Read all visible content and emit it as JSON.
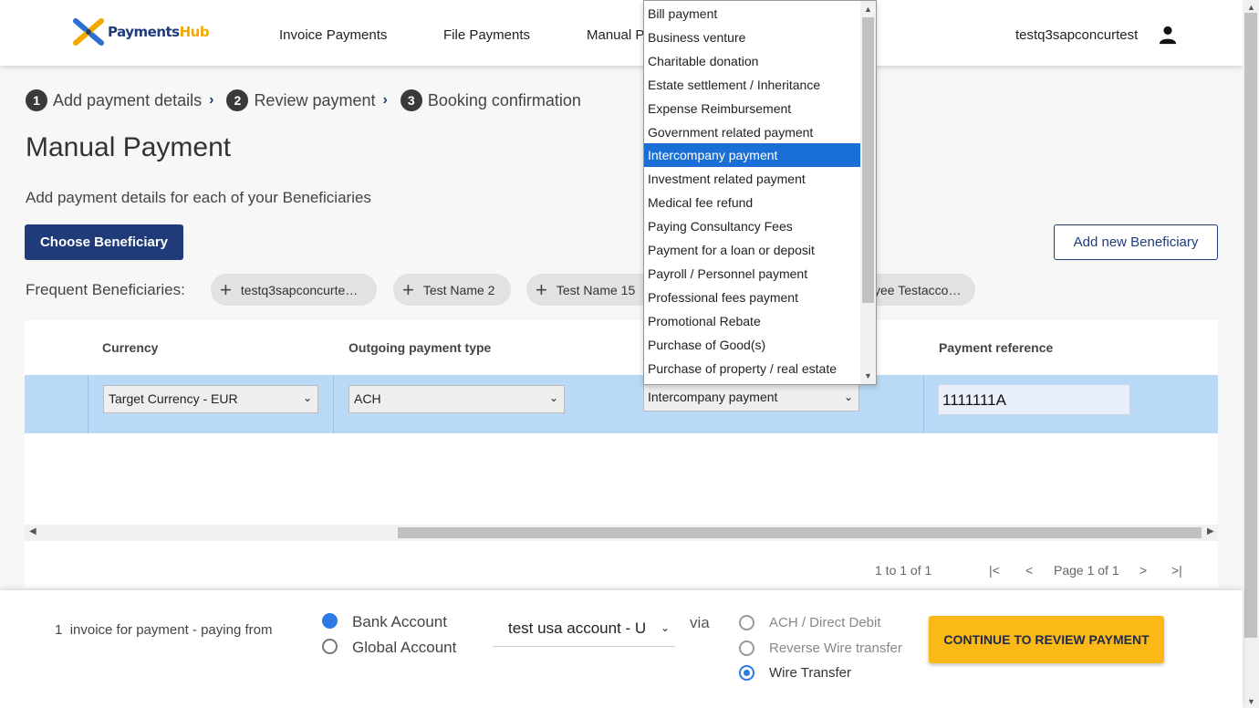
{
  "header": {
    "logo_text_a": "Payments",
    "logo_text_b": "Hub",
    "nav": [
      "Invoice Payments",
      "File Payments",
      "Manual P"
    ],
    "username": "testq3sapconcurtest"
  },
  "steps": [
    {
      "num": "1",
      "label": "Add payment details"
    },
    {
      "num": "2",
      "label": "Review payment"
    },
    {
      "num": "3",
      "label": "Booking confirmation"
    }
  ],
  "page": {
    "title": "Manual Payment",
    "subtitle": "Add payment details for each of your Beneficiaries",
    "choose_button": "Choose Beneficiary",
    "add_button": "Add new Beneficiary",
    "frequent_label": "Frequent Beneficiaries:",
    "chips": [
      "testq3sapconcurte…",
      "Test Name 2",
      "Test Name 15",
      "yee Testacco…"
    ]
  },
  "table": {
    "headers": {
      "currency": "Currency",
      "payment_type": "Outgoing payment type",
      "reference": "Payment reference"
    },
    "row": {
      "currency": "Target Currency - EUR",
      "payment_type": "ACH",
      "purpose": "Intercompany payment",
      "reference": "1111111A"
    },
    "pager": {
      "range": "1 to 1 of 1",
      "page": "Page 1 of 1",
      "first": "|<",
      "prev": "<",
      "next": ">",
      "last": ">|"
    }
  },
  "purpose_dropdown": {
    "selected_index": 6,
    "options": [
      "Bill payment",
      "Business venture",
      "Charitable donation",
      "Estate settlement / Inheritance",
      "Expense Reimbursement",
      "Government related payment",
      "Intercompany payment",
      "Investment related payment",
      "Medical fee refund",
      "Paying Consultancy Fees",
      "Payment for a loan or deposit",
      "Payroll / Personnel payment",
      "Professional fees payment",
      "Promotional Rebate",
      "Purchase of Good(s)",
      "Purchase of property / real estate"
    ]
  },
  "footer": {
    "count": "1",
    "count_text": "invoice for payment - paying from",
    "account_types": [
      "Bank Account",
      "Global Account"
    ],
    "account_selected": "Bank Account",
    "account_value": "test usa account - U",
    "via": "via",
    "methods": [
      "ACH / Direct Debit",
      "Reverse Wire transfer",
      "Wire Transfer"
    ],
    "method_selected": "Wire Transfer",
    "cta": "CONTINUE TO REVIEW PAYMENT"
  },
  "colors": {
    "brand_navy": "#1f3b7a",
    "accent_yellow": "#fbb917",
    "row_highlight": "#b9d9f6",
    "selection_blue": "#1a6fd6"
  }
}
